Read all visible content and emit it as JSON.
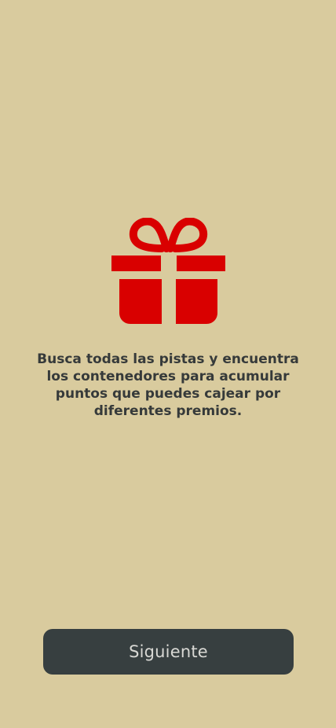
{
  "screen": {
    "icon": "gift-icon",
    "description": "Busca todas las pistas y encuentra los contenedores para acumular puntos que puedes cajear por diferentes premios.",
    "next_label": "Siguiente"
  },
  "colors": {
    "background": "#d9cb9e",
    "accent": "#d90000",
    "button": "#373f40",
    "text": "#363a3a"
  }
}
